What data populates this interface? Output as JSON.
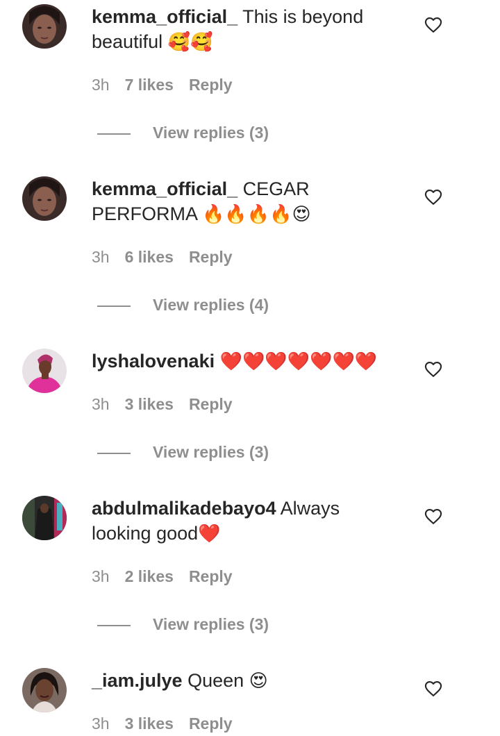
{
  "comments": [
    {
      "username": "kemma_official_",
      "text": " This is beyond beautiful ",
      "emoji": "🥰🥰",
      "time": "3h",
      "likes": "7 likes",
      "reply": "Reply",
      "view_replies": "View replies (3)",
      "avatar_icon": "profile-photo"
    },
    {
      "username": "kemma_official_",
      "text": " CEGAR PERFORMA ",
      "emoji": "🔥🔥🔥🔥😍",
      "time": "3h",
      "likes": "6 likes",
      "reply": "Reply",
      "view_replies": "View replies (4)",
      "avatar_icon": "profile-photo"
    },
    {
      "username": "lyshalovenaki",
      "text": " ",
      "emoji": "❤️❤️❤️❤️❤️❤️❤️",
      "time": "3h",
      "likes": "3 likes",
      "reply": "Reply",
      "view_replies": "View replies (3)",
      "avatar_icon": "profile-photo"
    },
    {
      "username": "abdulmalikadebayo4",
      "text": " Always looking good",
      "emoji": "❤️",
      "time": "3h",
      "likes": "2 likes",
      "reply": "Reply",
      "view_replies": "View replies (3)",
      "avatar_icon": "profile-photo"
    },
    {
      "username": "_iam.julye",
      "text": " Queen ",
      "emoji": "😍",
      "time": "3h",
      "likes": "3 likes",
      "reply": "Reply",
      "avatar_icon": "profile-photo"
    }
  ],
  "colors": {
    "text": "#262626",
    "secondary": "#8e8e8e",
    "background": "#ffffff"
  },
  "icons": {
    "like": "heart-outline-icon"
  }
}
